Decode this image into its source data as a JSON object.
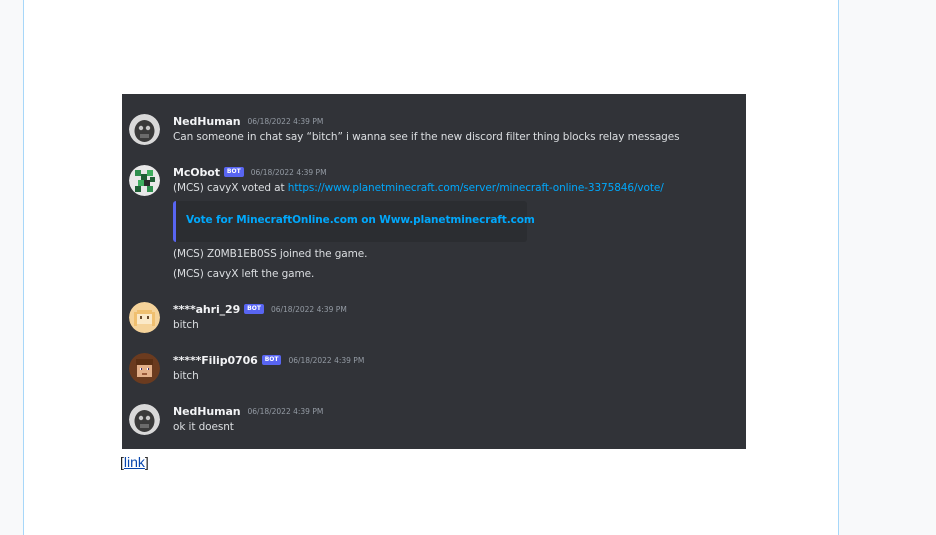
{
  "messages": [
    {
      "username": "NedHuman",
      "timestamp": "06/18/2022 4:39 PM",
      "lines": [
        "Can someone in chat say “bitch” i wanna see if the new discord filter thing blocks relay messages"
      ]
    },
    {
      "username": "McObot",
      "bot_tag": "BOT",
      "timestamp": "06/18/2022 4:39 PM",
      "vote_prefix": "(MCS) cavyX voted at ",
      "vote_url": "https://www.planetminecraft.com/server/minecraft-online-3375846/vote/",
      "embed_title": "Vote for MinecraftOnline.com on Www.planetminecraft.com",
      "lines_after": [
        "(MCS) Z0MB1EB0SS joined the game.",
        "(MCS) cavyX left the game."
      ]
    },
    {
      "username": "****ahri_29",
      "bot_tag": "BOT",
      "timestamp": "06/18/2022 4:39 PM",
      "lines": [
        "bitch"
      ]
    },
    {
      "username": "*****Filip0706",
      "bot_tag": "BOT",
      "timestamp": "06/18/2022 4:39 PM",
      "lines": [
        "bitch"
      ]
    },
    {
      "username": "NedHuman",
      "timestamp": "06/18/2022 4:39 PM",
      "lines": [
        "ok it doesnt"
      ]
    }
  ],
  "caption": {
    "open_bracket": "[",
    "link_text": "link",
    "close_bracket": "]"
  },
  "colors": {
    "discord_bg": "#313338",
    "embed_bg": "#2b2d31",
    "blurple": "#5865f2",
    "link": "#00a8fc",
    "wiki_link": "#0645ad"
  }
}
